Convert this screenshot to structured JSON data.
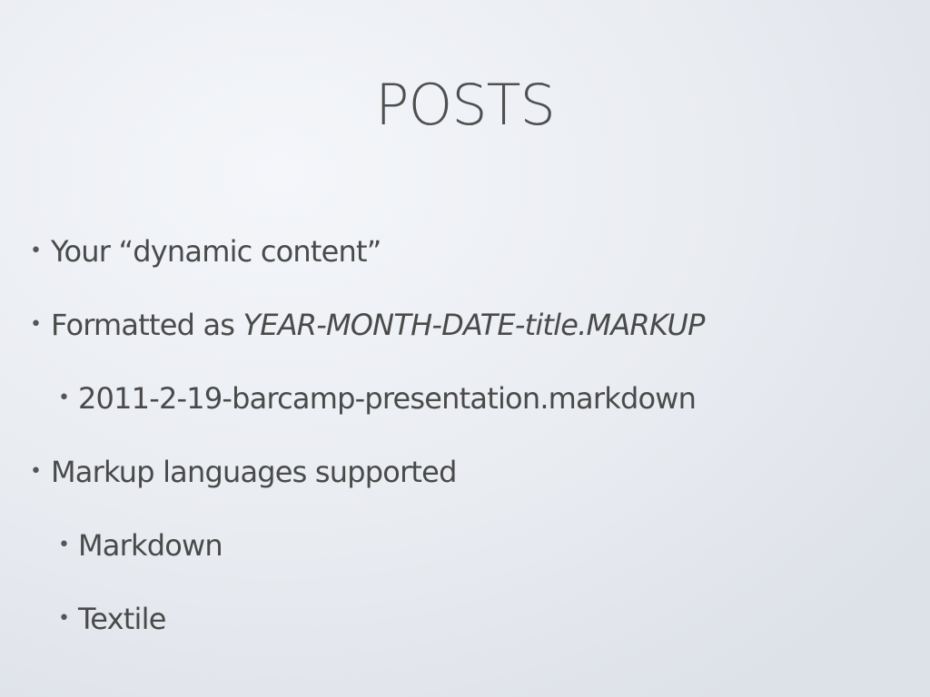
{
  "slide": {
    "title": "POSTS",
    "bullet_glyph": "•",
    "bullets": [
      {
        "text": "Your “dynamic content”"
      },
      {
        "text": "Formatted as ",
        "italic": "YEAR-MONTH-DATE-title.MARKUP"
      },
      {
        "text": "2011-2-19-barcamp-presentation.markdown"
      },
      {
        "text": "Markup languages supported"
      },
      {
        "text": "Markdown"
      },
      {
        "text": "Textile"
      }
    ]
  }
}
